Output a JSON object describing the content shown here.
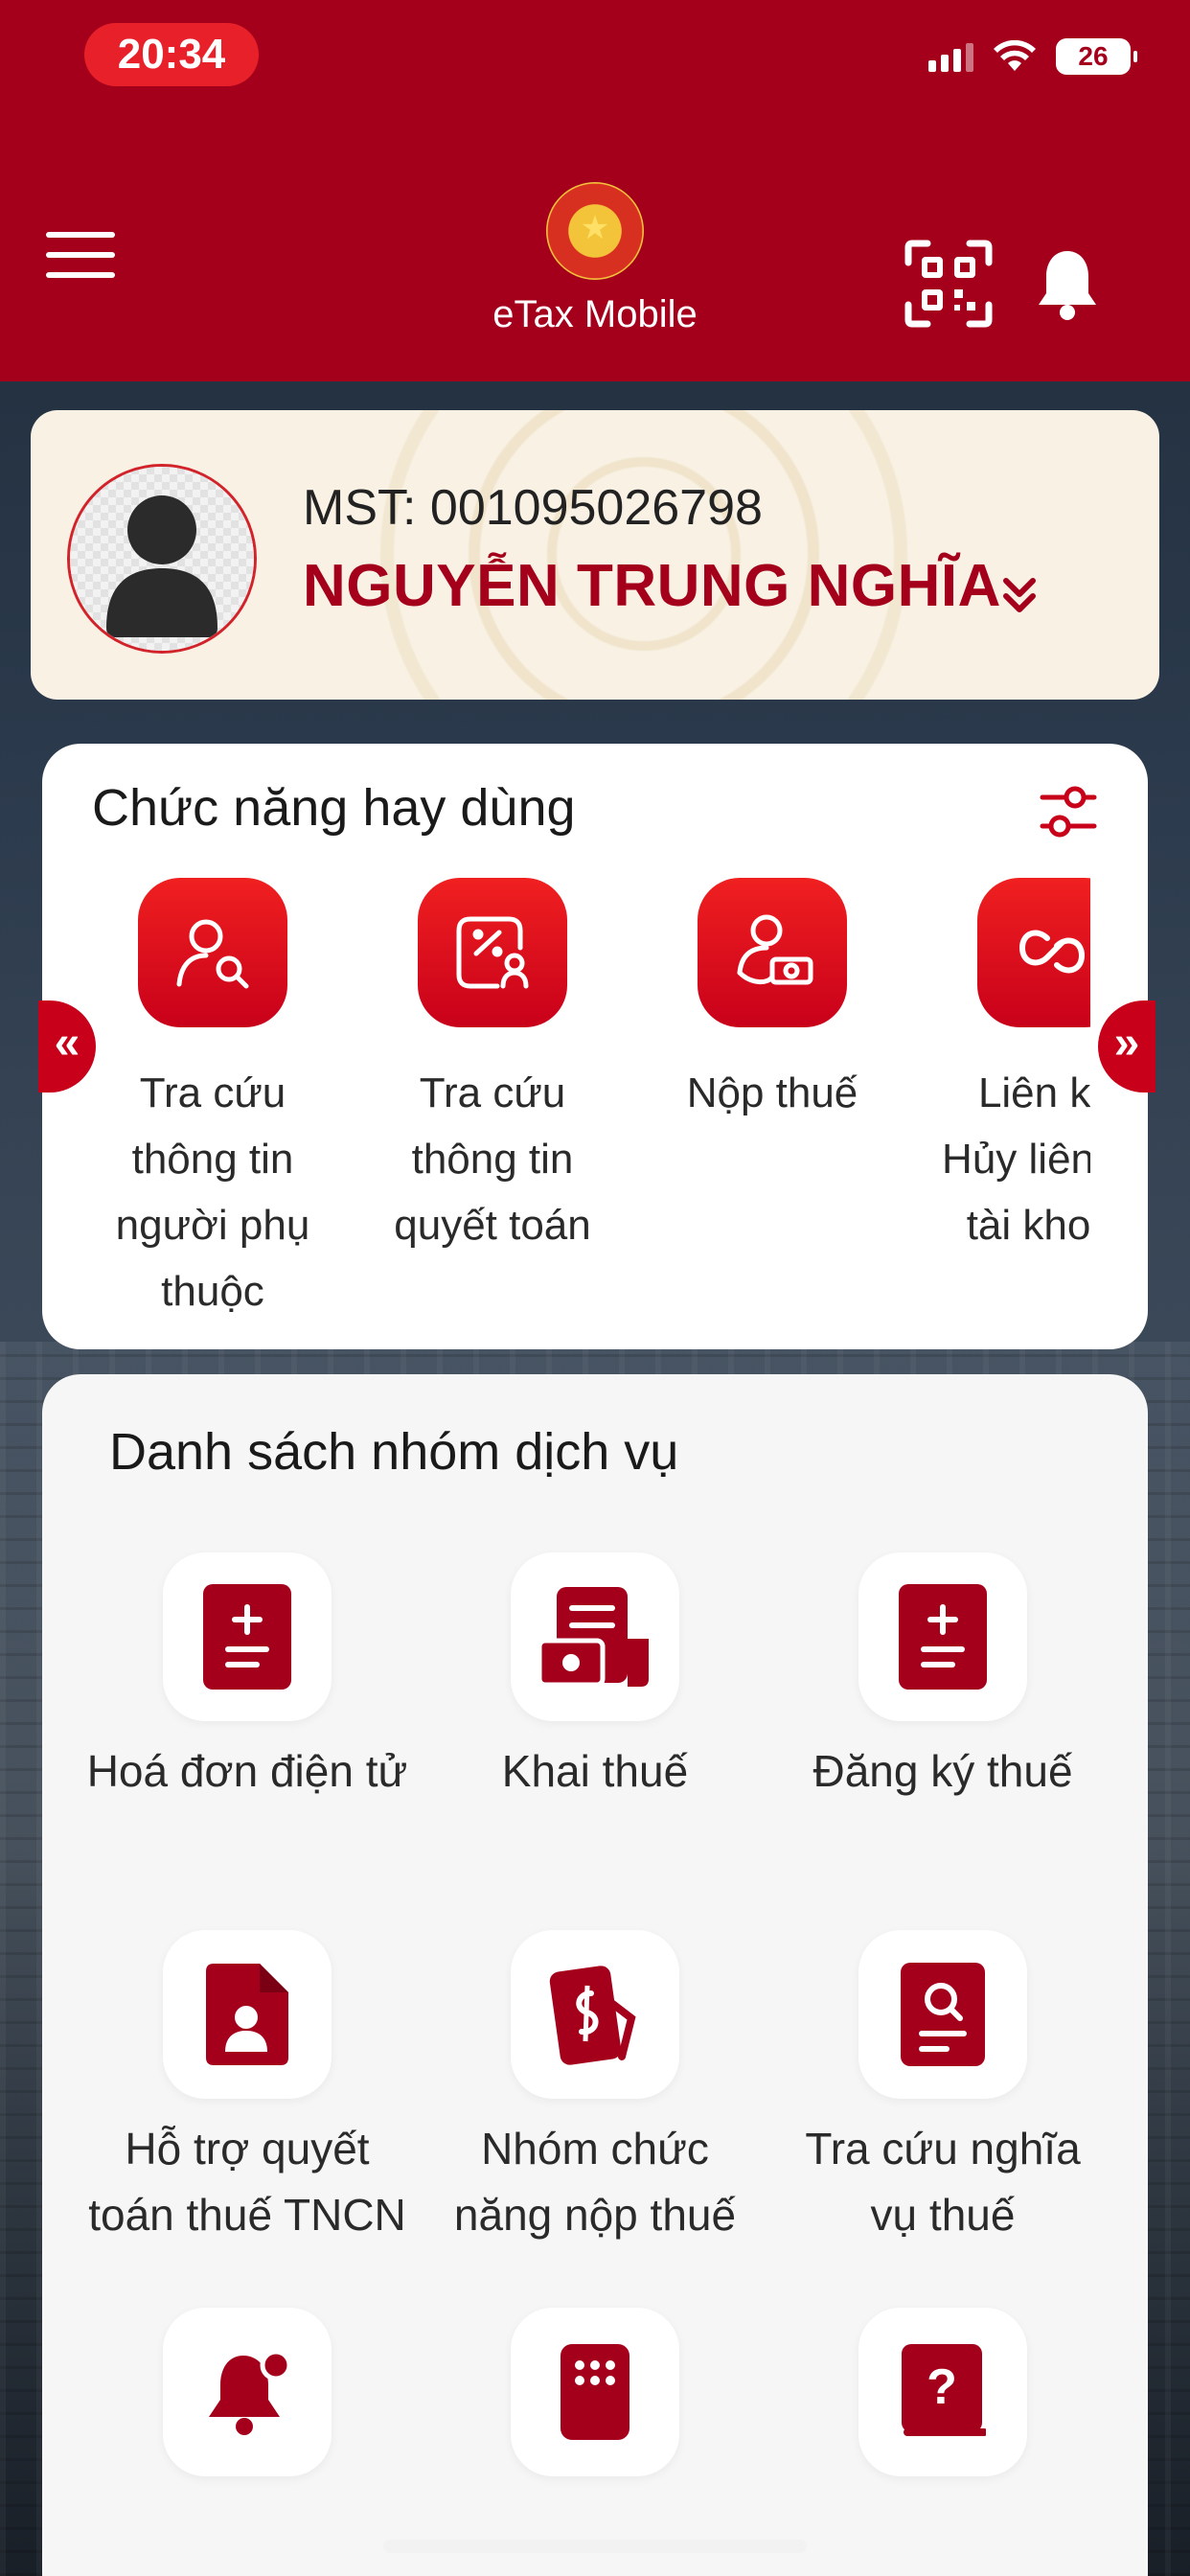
{
  "status_bar": {
    "time": "20:34",
    "battery": "26"
  },
  "header": {
    "app_name": "eTax Mobile",
    "logo_text": "★"
  },
  "profile": {
    "mst": "MST: 001095026798",
    "name": "NGUYỄN TRUNG NGHĨA"
  },
  "favorites": {
    "title": "Chức năng hay dùng",
    "items": [
      {
        "label": "Tra cứu thông tin người phụ thuộc",
        "icon": "person-search-icon"
      },
      {
        "label": "Tra cứu thông tin quyết toán",
        "icon": "tax-settlement-search-icon"
      },
      {
        "label": "Nộp thuế",
        "icon": "pay-tax-icon"
      },
      {
        "label": "Liên kết Hủy liên kết tài khoản",
        "icon": "link-account-icon"
      }
    ],
    "prev_arrow": "«",
    "next_arrow": "»"
  },
  "services": {
    "title": "Danh sách nhóm dịch vụ",
    "items": [
      {
        "label": "Hoá đơn điện tử",
        "icon": "invoice-icon"
      },
      {
        "label": "Khai thuế",
        "icon": "tax-declaration-icon"
      },
      {
        "label": "Đăng ký thuế",
        "icon": "tax-registration-icon"
      },
      {
        "label": "Hỗ trợ quyết toán thuế TNCN",
        "icon": "tax-settlement-support-icon"
      },
      {
        "label": "Nhóm chức năng nộp thuế",
        "icon": "tax-payment-group-icon"
      },
      {
        "label": "Tra cứu nghĩa vụ thuế",
        "icon": "tax-obligation-search-icon"
      },
      {
        "label": "",
        "icon": "notification-icon"
      },
      {
        "label": "",
        "icon": "keypad-icon"
      },
      {
        "label": "",
        "icon": "help-book-icon"
      }
    ]
  },
  "colors": {
    "brand": "#a5001b",
    "accent": "#e8202a",
    "card": "#ffffff"
  }
}
